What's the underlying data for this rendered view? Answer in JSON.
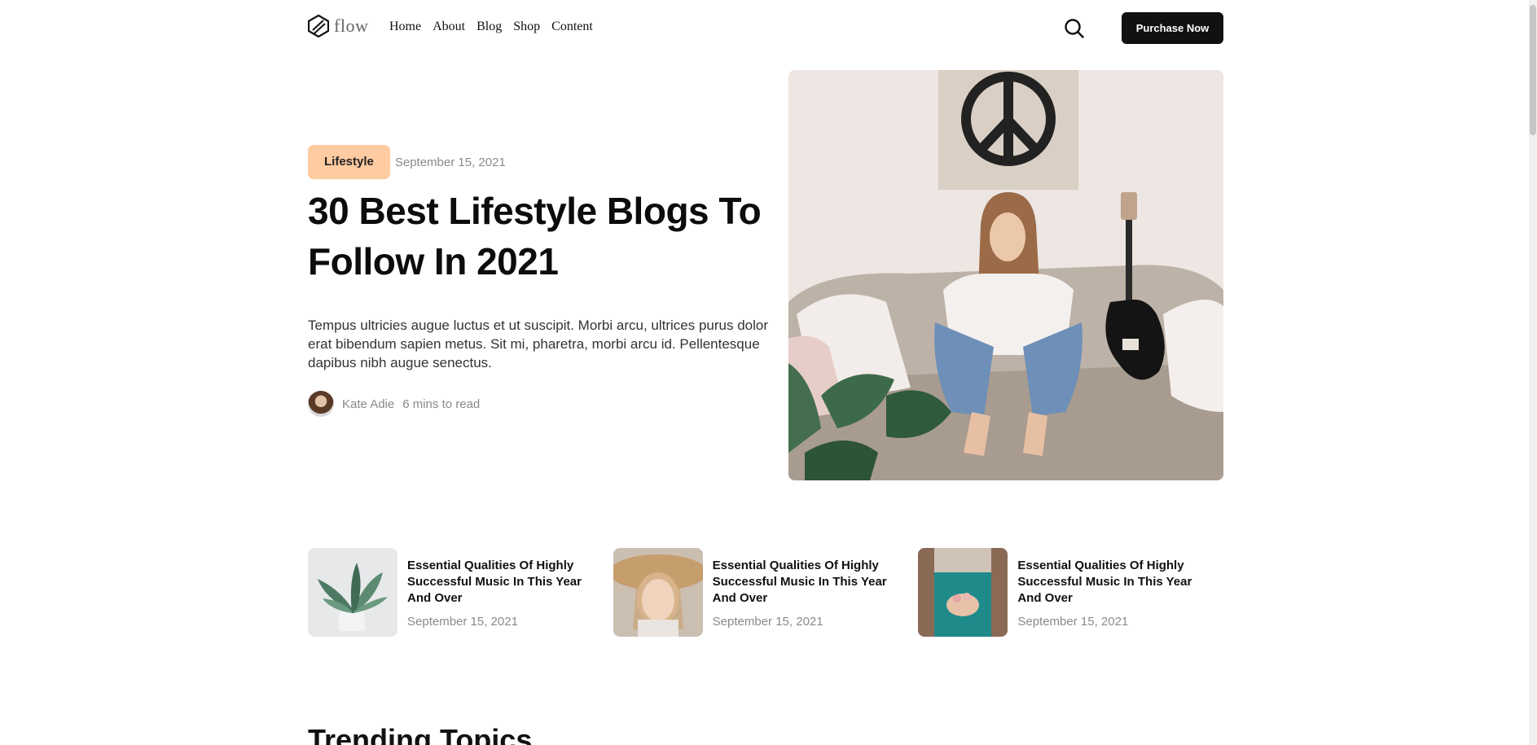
{
  "header": {
    "logo_text": "flow",
    "nav": [
      "Home",
      "About",
      "Blog",
      "Shop",
      "Content"
    ],
    "purchase_label": "Purchase Now"
  },
  "hero": {
    "category": "Lifestyle",
    "date": "September 15, 2021",
    "title": "30 Best Lifestyle Blogs To Follow In 2021",
    "description": "Tempus ultricies augue luctus et ut suscipit. Morbi arcu, ultrices purus dolor erat bibendum sapien metus. Sit mi, pharetra, morbi arcu id. Pellentesque dapibus nibh augue senectus.",
    "author": "Kate Adie",
    "read_time": "6 mins to read"
  },
  "cards": [
    {
      "title": "Essential Qualities Of Highly Successful Music In This Year And Over",
      "date": "September 15, 2021"
    },
    {
      "title": "Essential Qualities Of Highly Successful Music In This Year And Over",
      "date": "September 15, 2021"
    },
    {
      "title": "Essential Qualities Of Highly Successful Music In This Year And Over",
      "date": "September 15, 2021"
    }
  ],
  "trending_title": "Trending Topics",
  "colors": {
    "badge": "#ffcba0",
    "button": "#111111",
    "muted": "#8a8a8a"
  }
}
